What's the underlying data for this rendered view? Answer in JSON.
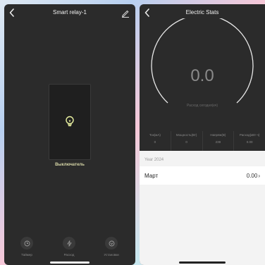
{
  "left_screen": {
    "title": "Smart relay-1",
    "relay_label": "Выключатель",
    "nav": [
      {
        "label": "Таймер",
        "icon": "clock-icon"
      },
      {
        "label": "Расход",
        "icon": "lightning-icon"
      },
      {
        "label": "Установки",
        "icon": "settings-icon"
      }
    ]
  },
  "right_screen": {
    "title": "Electric Stats",
    "gauge": {
      "value": "0.0",
      "caption": "Расход сегодня(кч)"
    },
    "stats": [
      {
        "label": "Ток(мА)",
        "value": "0"
      },
      {
        "label": "Мощность(Вт)",
        "value": "0"
      },
      {
        "label": "Напряж(В)",
        "value": "239"
      },
      {
        "label": "Расход(кВт·ч)",
        "value": "0.00"
      }
    ],
    "year_header": "Year 2024",
    "months": [
      {
        "name": "Март",
        "value": "0.00"
      }
    ]
  },
  "colors": {
    "background_dark": "#2b2b2b",
    "tile": "#1f1f1f",
    "bulb_glow": "#e8f0a0",
    "list_bg": "#f3f3f3"
  }
}
